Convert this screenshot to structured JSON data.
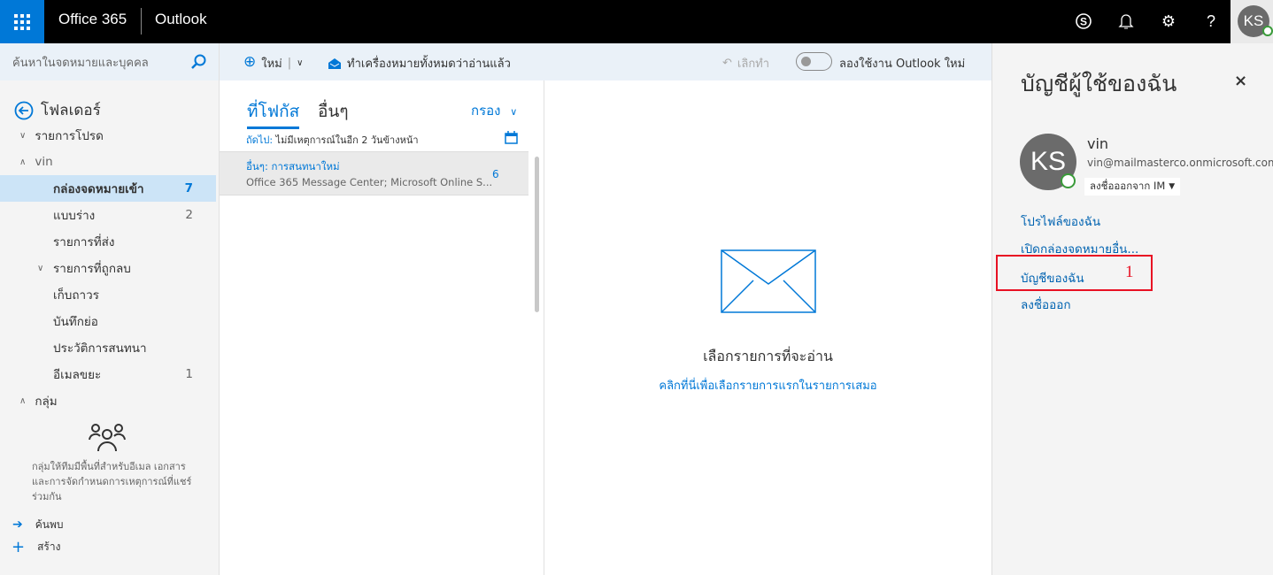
{
  "topbar": {
    "suite": "Office 365",
    "app": "Outlook",
    "avatar_initials": "KS"
  },
  "search": {
    "placeholder": "ค้นหาในจดหมายและบุคคล"
  },
  "folders": {
    "header": "โฟลเดอร์",
    "favorites": "รายการโปรด",
    "account": "vin",
    "items": [
      {
        "label": "กล่องจดหมายเข้า",
        "count": "7"
      },
      {
        "label": "แบบร่าง",
        "count": "2"
      },
      {
        "label": "รายการที่ส่ง",
        "count": ""
      },
      {
        "label": "รายการที่ถูกลบ",
        "count": ""
      },
      {
        "label": "เก็บถาวร",
        "count": ""
      },
      {
        "label": "บันทึกย่อ",
        "count": ""
      },
      {
        "label": "ประวัติการสนทนา",
        "count": ""
      },
      {
        "label": "อีเมลขยะ",
        "count": "1"
      }
    ],
    "groups": "กลุ่ม",
    "groups_desc": "กลุ่มให้ทีมมีพื้นที่สำหรับอีเมล เอกสาร และการจัดกำหนดการเหตุการณ์ที่แชร์ร่วมกัน",
    "discover": "ค้นพบ",
    "create": "สร้าง"
  },
  "commands": {
    "new": "ใหม่",
    "mark_all_read": "ทำเครื่องหมายทั้งหมดว่าอ่านแล้ว",
    "undo": "เลิกทำ",
    "try_new": "ลองใช้งาน Outlook ใหม่",
    "try_new_on": false
  },
  "list": {
    "tab_focused": "ที่โฟกัส",
    "tab_other": "อื่นๆ",
    "filter": "กรอง",
    "next_label": "ถัดไป:",
    "next_text": "ไม่มีเหตุการณ์ในอีก 2 วันข้างหน้า",
    "messages": [
      {
        "title": "อื่นๆ: การสนทนาใหม่",
        "preview": "Office 365 Message Center; Microsoft Online S...",
        "count": "6"
      }
    ]
  },
  "reading": {
    "title": "เลือกรายการที่จะอ่าน",
    "link": "คลิกที่นี่เพื่อเลือกรายการแรกในรายการเสมอ"
  },
  "account_panel": {
    "title": "บัญชีผู้ใช้ของฉัน",
    "name": "vin",
    "email": "vin@mailmasterco.onmicrosoft.com",
    "initials": "KS",
    "im_status": "ลงชื่อออกจาก IM",
    "links": [
      "โปรไฟล์ของฉัน",
      "เปิดกล่องจดหมายอื่น...",
      "บัญชีของฉัน",
      "ลงชื่อออก"
    ],
    "annotation": "1"
  },
  "colors": {
    "accent": "#0078d7",
    "highlight_box": "#e81123"
  }
}
